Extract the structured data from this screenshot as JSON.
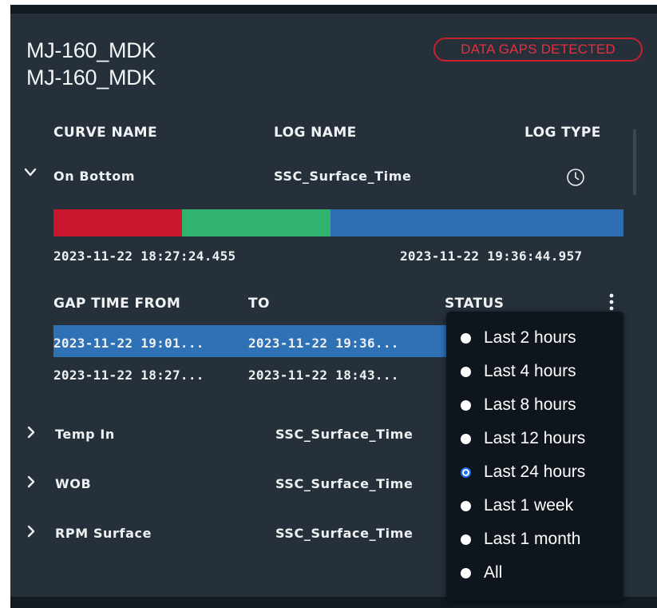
{
  "header": {
    "title_line1": "MJ-160_MDK",
    "title_line2": "MJ-160_MDK",
    "badge": "DATA GAPS DETECTED"
  },
  "columns": {
    "curve_name": "CURVE NAME",
    "log_name": "LOG NAME",
    "log_type": "LOG TYPE"
  },
  "expanded_curve": {
    "name": "On Bottom",
    "log_name": "SSC_Surface_Time",
    "log_type_icon": "clock-icon",
    "timeline": {
      "start": "2023-11-22 18:27:24.455",
      "end": "2023-11-22 19:36:44.957",
      "segments": [
        {
          "color": "#c8172c",
          "fraction": 0.226
        },
        {
          "color": "#2fb36f",
          "fraction": 0.26
        },
        {
          "color": "#2f6db2",
          "fraction": 0.514
        }
      ]
    },
    "gap_table": {
      "headers": {
        "from": "GAP TIME FROM",
        "to": "TO",
        "status": "STATUS"
      },
      "menu_icon": "kebab-menu-icon",
      "rows": [
        {
          "from": "2023-11-22 19:01...",
          "to": "2023-11-22 19:36...",
          "selected": true
        },
        {
          "from": "2023-11-22 18:27...",
          "to": "2023-11-22 18:43...",
          "selected": false
        }
      ]
    }
  },
  "collapsed_curves": [
    {
      "name": "Temp In",
      "log_name": "SSC_Surface_Time"
    },
    {
      "name": "WOB",
      "log_name": "SSC_Surface_Time"
    },
    {
      "name": "RPM Surface",
      "log_name": "SSC_Surface_Time"
    }
  ],
  "time_range_menu": {
    "options": [
      {
        "label": "Last 2 hours",
        "selected": false
      },
      {
        "label": "Last 4 hours",
        "selected": false
      },
      {
        "label": "Last 8 hours",
        "selected": false
      },
      {
        "label": "Last 12 hours",
        "selected": false
      },
      {
        "label": "Last 24 hours",
        "selected": true
      },
      {
        "label": "Last 1 week",
        "selected": false
      },
      {
        "label": "Last 1 month",
        "selected": false
      },
      {
        "label": "All",
        "selected": false
      }
    ]
  },
  "colors": {
    "panel_bg": "#25303b",
    "accent_blue": "#2e72b5",
    "alert_red": "#c8202e"
  }
}
